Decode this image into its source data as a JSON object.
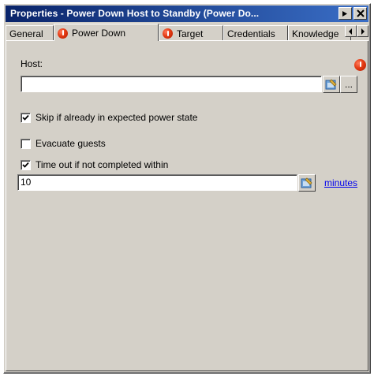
{
  "window": {
    "title": "Properties - Power Down Host to Standby (Power Do..."
  },
  "tabs": [
    {
      "label": "General",
      "error": false
    },
    {
      "label": "Power Down",
      "error": true,
      "active": true
    },
    {
      "label": "Target",
      "error": true
    },
    {
      "label": "Credentials",
      "error": false
    },
    {
      "label": "Knowledge",
      "error": false
    }
  ],
  "form": {
    "host": {
      "label": "Host:",
      "value": "",
      "browse_label": "..."
    },
    "skip_checkbox": {
      "label": "Skip if already in expected power state",
      "checked": true
    },
    "evacuate_checkbox": {
      "label": "Evacuate guests",
      "checked": false
    },
    "timeout_checkbox": {
      "label": "Time out if not completed within",
      "checked": true
    },
    "timeout_value": "10",
    "timeout_unit_link": "minutes"
  },
  "colors": {
    "titlebar_start": "#0a246a",
    "titlebar_end": "#3a6ec6",
    "face": "#d4d0c8",
    "error": "#e43b14",
    "link": "#0000ee"
  },
  "icons": [
    "pin-icon",
    "close-icon",
    "error-icon",
    "scroll-left-icon",
    "scroll-right-icon",
    "variable-picker-icon",
    "checkmark-icon"
  ]
}
